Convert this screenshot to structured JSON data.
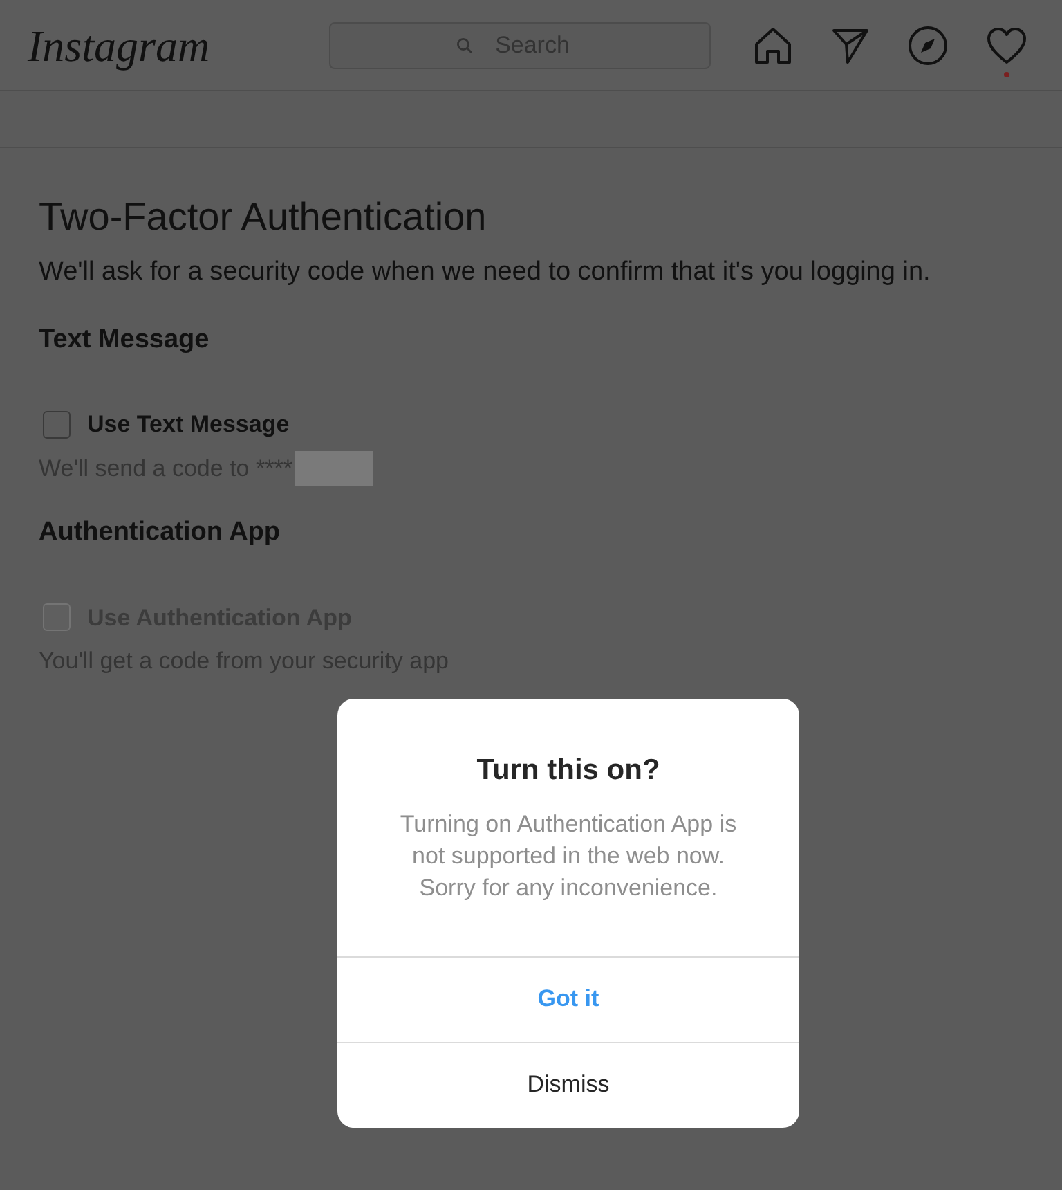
{
  "header": {
    "logo": "Instagram",
    "search": {
      "placeholder": "Search"
    },
    "notification_dot": true
  },
  "page": {
    "title": "Two-Factor Authentication",
    "description": "We'll ask for a security code when we need to confirm that it's you logging in.",
    "sections": [
      {
        "heading": "Text Message",
        "option": {
          "label": "Use Text Message",
          "checked": false,
          "disabled": false
        },
        "note": "We'll send a code to ****",
        "redacted": true
      },
      {
        "heading": "Authentication App",
        "option": {
          "label": "Use Authentication App",
          "checked": false,
          "disabled": true
        },
        "note": "You'll get a code from your security app"
      }
    ]
  },
  "dialog": {
    "title": "Turn this on?",
    "message": "Turning on Authentication App is not supported in the web now. Sorry for any inconvenience.",
    "buttons": [
      {
        "label": "Got it",
        "kind": "primary"
      },
      {
        "label": "Dismiss",
        "kind": "secondary"
      }
    ]
  }
}
